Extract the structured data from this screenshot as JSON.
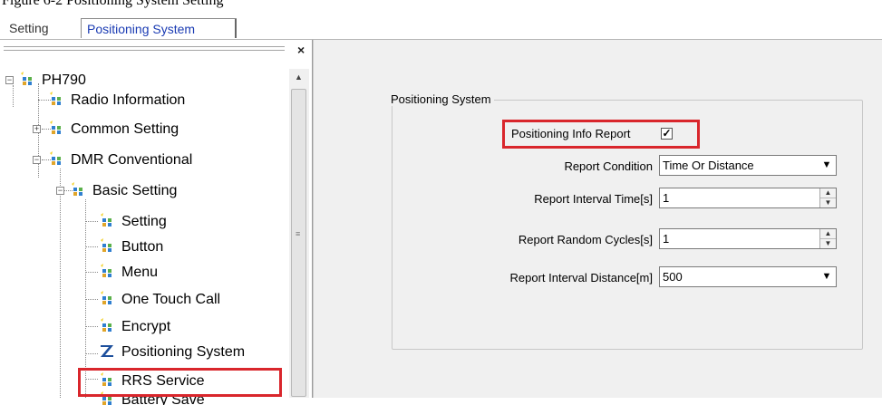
{
  "caption": "Figure 6-2 Positioning System Setting",
  "tabs": [
    {
      "label": "Setting"
    },
    {
      "label": "Positioning System"
    }
  ],
  "tree": {
    "root": "PH790",
    "items": [
      {
        "label": "Radio Information"
      },
      {
        "label": "Common Setting"
      },
      {
        "label": "DMR Conventional"
      },
      {
        "label": "Basic Setting"
      },
      {
        "label": "Setting"
      },
      {
        "label": "Button"
      },
      {
        "label": "Menu"
      },
      {
        "label": "One Touch Call"
      },
      {
        "label": "Encrypt"
      },
      {
        "label": "Positioning System"
      },
      {
        "label": "RRS Service"
      },
      {
        "label": "Battery Save"
      }
    ]
  },
  "panel": {
    "group_title": "Positioning System",
    "positioning_info_report": {
      "label": "Positioning Info Report",
      "checked": true
    },
    "report_condition": {
      "label": "Report Condition",
      "value": "Time Or Distance"
    },
    "report_interval_time": {
      "label": "Report Interval Time[s]",
      "value": "1"
    },
    "report_random_cycles": {
      "label": "Report Random Cycles[s]",
      "value": "1"
    },
    "report_interval_distance": {
      "label": "Report Interval Distance[m]",
      "value": "500"
    }
  },
  "colors": {
    "highlight": "#d9262c",
    "active_tab": "#1a3bb3"
  },
  "icons": {
    "tree_node": "folder-sparkle-icon",
    "selected_node": "z-logo-icon"
  }
}
